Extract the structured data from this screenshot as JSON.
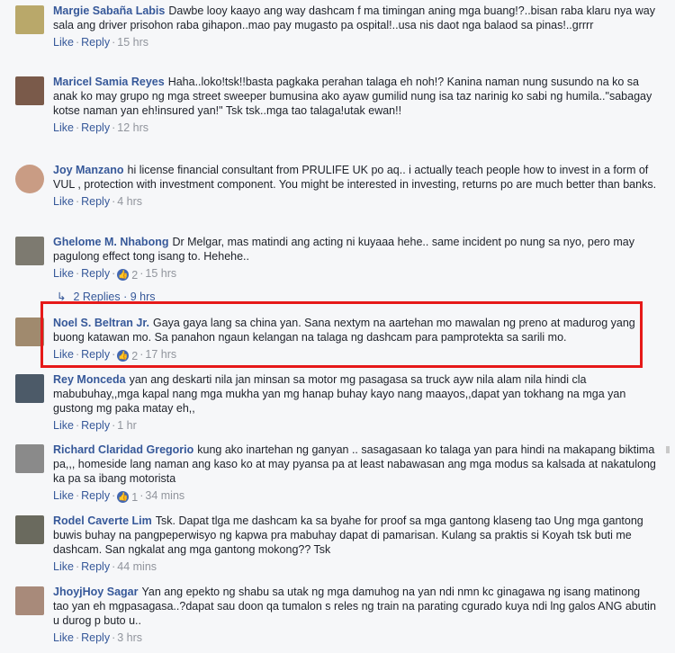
{
  "ui": {
    "like": "Like",
    "reply": "Reply",
    "dot": "·"
  },
  "comments": [
    {
      "author": "Margie Sabaña Labis",
      "text": "Dawbe looy kaayo ang way dashcam f ma timingan aning mga buang!?..bisan raba klaru nya way sala ang driver prisohon raba gihapon..mao pay mugasto pa ospital!..usa nis daot nga balaod sa pinas!..grrrr",
      "time": "15 hrs",
      "reactions": null,
      "avatar_color": "#b9a86a"
    },
    {
      "author": "Maricel Samia Reyes",
      "text": "Haha..loko!tsk!!basta pagkaka perahan talaga eh noh!? Kanina naman nung susundo na ko sa anak ko may grupo ng mga street sweeper bumusina ako ayaw gumilid nung isa taz narinig ko sabi ng humila..\"sabagay kotse naman yan eh!insured yan!\" Tsk tsk..mga tao talaga!utak ewan!!",
      "time": "12 hrs",
      "reactions": null,
      "avatar_color": "#7a5a4a"
    },
    {
      "author": "Joy Manzano",
      "text": "hi license financial consultant from PRULIFE UK po aq.. i actually teach people how to invest in a form of VUL , protection with investment component. You might be interested in investing, returns po are much better than banks.",
      "time": "4 hrs",
      "reactions": null,
      "avatar_color": "#c99c84"
    },
    {
      "author": "Ghelome M. Nhabong",
      "text": "Dr Melgar, mas matindi ang acting ni kuyaaa hehe.. same incident po nung sa nyo, pero may pagulong effect tong isang to. Hehehe..",
      "time": "15 hrs",
      "reactions": "2",
      "avatar_color": "#7d7a70"
    },
    {
      "author": "Noel S. Beltran Jr.",
      "text": "Gaya gaya lang sa china yan. Sana nextym na aartehan mo mawalan ng preno at madurog yang buong katawan mo. Sa panahon ngaun kelangan na talaga ng dashcam para pamprotekta sa sarili mo.",
      "time": "17 hrs",
      "reactions": "2",
      "avatar_color": "#a08a6e"
    },
    {
      "author": "Rey Monceda",
      "text": "yan ang deskarti nila jan minsan sa motor mg pasagasa sa truck ayw nila alam nila hindi cla mabubuhay,,mga kapal nang mga mukha yan mg hanap buhay kayo nang maayos,,dapat yan tokhang na mga yan gustong mg paka matay eh,,",
      "time": "1 hr",
      "reactions": null,
      "avatar_color": "#4c5a68"
    },
    {
      "author": "Richard Claridad Gregorio",
      "text": "kung ako inartehan ng ganyan .. sasagasaan ko talaga yan para hindi na makapang biktima pa,,, homeside lang naman ang kaso ko at may pyansa pa at least nabawasan ang mga modus sa kalsada at nakatulong ka pa sa ibang motorista",
      "time": "34 mins",
      "reactions": "1",
      "avatar_color": "#8a8a8a"
    },
    {
      "author": "Rodel Caverte Lim",
      "text": "Tsk. Dapat tlga me dashcam ka sa byahe for proof sa mga gantong klaseng tao Ung mga gantong buwis buhay na pangpeperwisyo ng kapwa pra mabuhay dapat di pamarisan. Kulang sa praktis si Koyah tsk buti me dashcam. San ngkalat ang mga gantong mokong?? Tsk",
      "time": "44 mins",
      "reactions": null,
      "avatar_color": "#6a6a5e"
    },
    {
      "author": "JhoyjHoy Sagar",
      "text": "Yan ang epekto ng shabu sa utak ng mga damuhog na yan ndi nmn kc ginagawa ng isang matinong tao yan eh mgpasagasa..?dapat sau doon qa tumalon s reles ng train na parating cgurado kuya ndi lng galos ANG abutin u durog p buto u..",
      "time": "3 hrs",
      "reactions": null,
      "avatar_color": "#a88a7a"
    }
  ],
  "replies_link": "2 Replies · 9 hrs",
  "highlight_color": "#e61919"
}
